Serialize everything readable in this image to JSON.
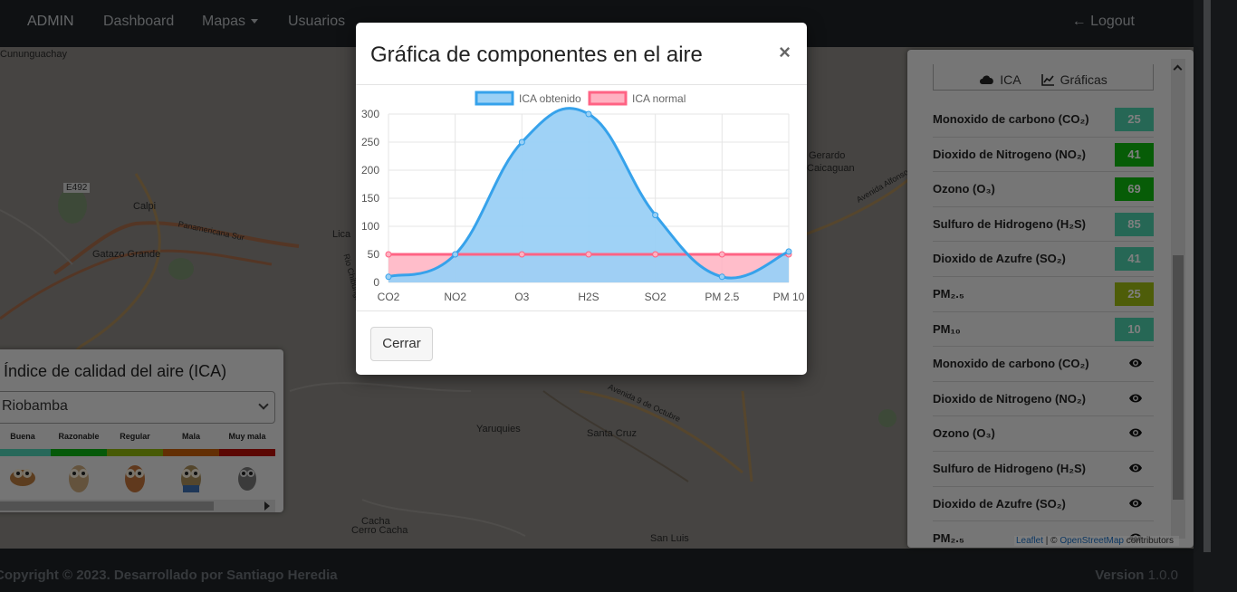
{
  "navbar": {
    "brand": "ADMIN",
    "items": [
      {
        "label": "Dashboard"
      },
      {
        "label": "Mapas"
      },
      {
        "label": "Usuarios"
      }
    ],
    "logout": "Logout"
  },
  "map": {
    "labels": [
      "Cununguachay",
      "E492",
      "Calpi",
      "Panamericana Sur",
      "Gatazo Grande",
      "Lica",
      "Gerardo",
      "Caicaguan",
      "Avenida 9 de Octubre",
      "Yaruquies",
      "Santa Cruz",
      "Cacha",
      "Cerro Cacha",
      "San Luis",
      "Rio Chibunga",
      "Avenida Alfonso Chavez"
    ],
    "attribution": {
      "leaflet": "Leaflet",
      "separator": " | © ",
      "osm": "OpenStreetMap",
      "suffix": " contributors"
    }
  },
  "ica_legend": {
    "title": "Índice de calidad del aire (ICA)",
    "city": "Riobamba",
    "categories": [
      "Buena",
      "Razonable",
      "Regular",
      "Mala",
      "Muy mala"
    ],
    "colors": [
      "#4fd0b4",
      "#0bb313",
      "#8eb40a",
      "#c75f08",
      "#b70f07"
    ]
  },
  "right_panel": {
    "tabs": [
      {
        "label": "ICA",
        "icon": "cloud-icon"
      },
      {
        "label": "Gráficas",
        "icon": "line-chart-icon"
      }
    ],
    "components": [
      {
        "name": "Monoxido de carbono (CO₂)",
        "value": "25",
        "color": "#4ccfaa"
      },
      {
        "name": "Dioxido de Nitrogeno (NO₂)",
        "value": "41",
        "color": "#0fb80f"
      },
      {
        "name": "Ozono (O₃)",
        "value": "69",
        "color": "#0fb80f"
      },
      {
        "name": "Sulfuro de Hidrogeno (H₂S)",
        "value": "85",
        "color": "#4ccfaa"
      },
      {
        "name": "Dioxido de Azufre (SO₂)",
        "value": "41",
        "color": "#4ccfaa"
      },
      {
        "name": "PM₂.₅",
        "value": "25",
        "color": "#9cba12"
      },
      {
        "name": "PM₁₀",
        "value": "10",
        "color": "#4ccfaa"
      }
    ],
    "chart_links": [
      {
        "name": "Monoxido de carbono (CO₂)"
      },
      {
        "name": "Dioxido de Nitrogeno (NO₂)"
      },
      {
        "name": "Ozono (O₃)"
      },
      {
        "name": "Sulfuro de Hidrogeno (H₂S)"
      },
      {
        "name": "Dioxido de Azufre (SO₂)"
      },
      {
        "name": "PM₂.₅"
      }
    ]
  },
  "modal": {
    "title": "Gráfica de componentes en el aire",
    "close": "×",
    "button": "Cerrar"
  },
  "chart_data": {
    "type": "area",
    "categories": [
      "CO2",
      "NO2",
      "O3",
      "H2S",
      "SO2",
      "PM 2.5",
      "PM 10"
    ],
    "series": [
      {
        "name": "ICA obtenido",
        "values": [
          10,
          50,
          250,
          300,
          120,
          10,
          55
        ],
        "color": "#36a2eb",
        "fill": "#9ad0f5"
      },
      {
        "name": "ICA normal",
        "values": [
          50,
          50,
          50,
          50,
          50,
          50,
          50
        ],
        "color": "#ff6384",
        "fill": "#ffb1c1"
      }
    ],
    "ylim": [
      0,
      300
    ],
    "yticks": [
      0,
      50,
      100,
      150,
      200,
      250,
      300
    ],
    "legend": "top",
    "grid": true
  },
  "footer": {
    "copyright": "Copyright © 2023. Desarrollado por Santiago Heredia",
    "version_label": "Version",
    "version": "1.0.0"
  }
}
